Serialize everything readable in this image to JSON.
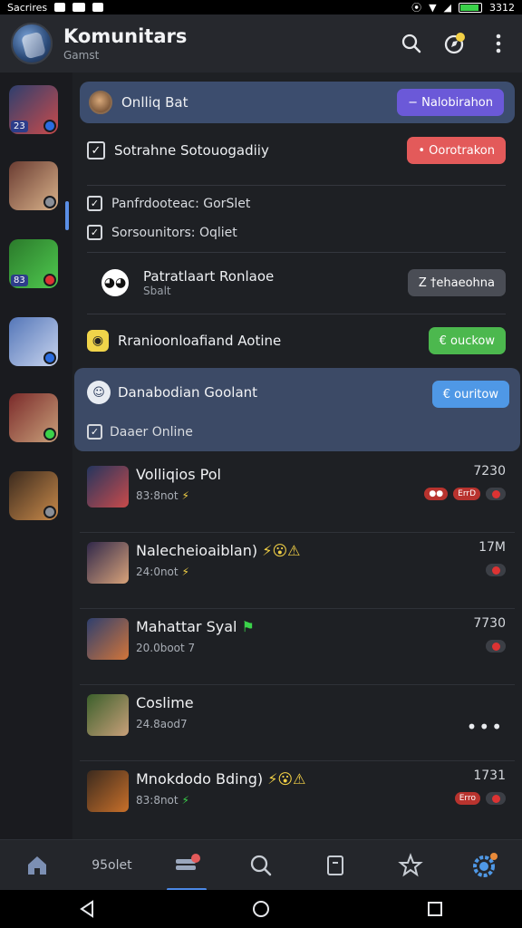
{
  "status_bar": {
    "carrier": "Sacrires",
    "time": "3312"
  },
  "header": {
    "title": "Komunitars",
    "subtitle": "Gamst",
    "notification_icon_color": "#f2d046"
  },
  "sidebar": {
    "servers": [
      {
        "badge": "23",
        "colors": [
          "#2e3f6e",
          "#c94b4b"
        ]
      },
      {
        "badge": "",
        "colors": [
          "#6a3c32",
          "#d9b28a"
        ]
      },
      {
        "badge": "83",
        "colors": [
          "#2b7a2b",
          "#4fc94f"
        ]
      },
      {
        "badge": "",
        "colors": [
          "#5476b8",
          "#c8d4ee"
        ]
      },
      {
        "badge": "",
        "colors": [
          "#7a2a2a",
          "#c9a07a"
        ]
      },
      {
        "badge": "",
        "colors": [
          "#3b2a1e",
          "#c98a4a"
        ]
      }
    ]
  },
  "online_card": {
    "label": "Onlliq Bat",
    "button_label": "− Nalobirahon",
    "button_color": "#6b59d8"
  },
  "section": {
    "header_label": "Sotrahne Sotouogadiiy",
    "header_button": "• Oorotrakon",
    "header_button_color": "#e35a5a",
    "rows": [
      {
        "label": "Panfrdooteac: GorSlet"
      },
      {
        "label": "Sorsounitors: Oqliet"
      }
    ],
    "person": {
      "name": "Patratlaart Ronlaoe",
      "sub": "Sbalt",
      "button_label": "Z †ehaeohna",
      "button_color": "#4a4d55"
    },
    "room": {
      "label": "Rranioonloafiand Aotine",
      "button_label": "€ ouckow",
      "button_color": "#4cb84e"
    },
    "active": {
      "label": "Danabodian Goolant",
      "sub": "Daaer Online",
      "button_label": "€ ouritow",
      "button_color": "#4f98e6"
    }
  },
  "list": [
    {
      "name": "Volliqios Pol",
      "sub": "83:8not",
      "emoji": "⚡",
      "time": "7230",
      "tag": "ErrD",
      "thumb": [
        "#24355e",
        "#c94b4b"
      ]
    },
    {
      "name": "Nalecheioaiblan)",
      "sub": "24:0not",
      "emoji": "⚡😮⚠",
      "time": "17M",
      "tag": "",
      "thumb": [
        "#30284a",
        "#d9a37a"
      ]
    },
    {
      "name": "Mahattar Syal",
      "sub": "20.0boot 7",
      "emoji": "⚑",
      "time": "7730",
      "tag": "",
      "thumb": [
        "#2e3f6e",
        "#d2753a"
      ]
    },
    {
      "name": "Coslime",
      "sub": "24.8aod7",
      "emoji": "",
      "time": "",
      "tag": "•••",
      "thumb": [
        "#3b5f2b",
        "#c9a07a"
      ]
    },
    {
      "name": "Mnokdodo Bding)",
      "sub": "83:8not",
      "emoji": "⚡😮⚠",
      "time": "1731",
      "tag": "Erro",
      "thumb": [
        "#3b2a1e",
        "#c9702a"
      ]
    }
  ],
  "bottom_nav": {
    "label": "95olet",
    "active_index": 2
  }
}
